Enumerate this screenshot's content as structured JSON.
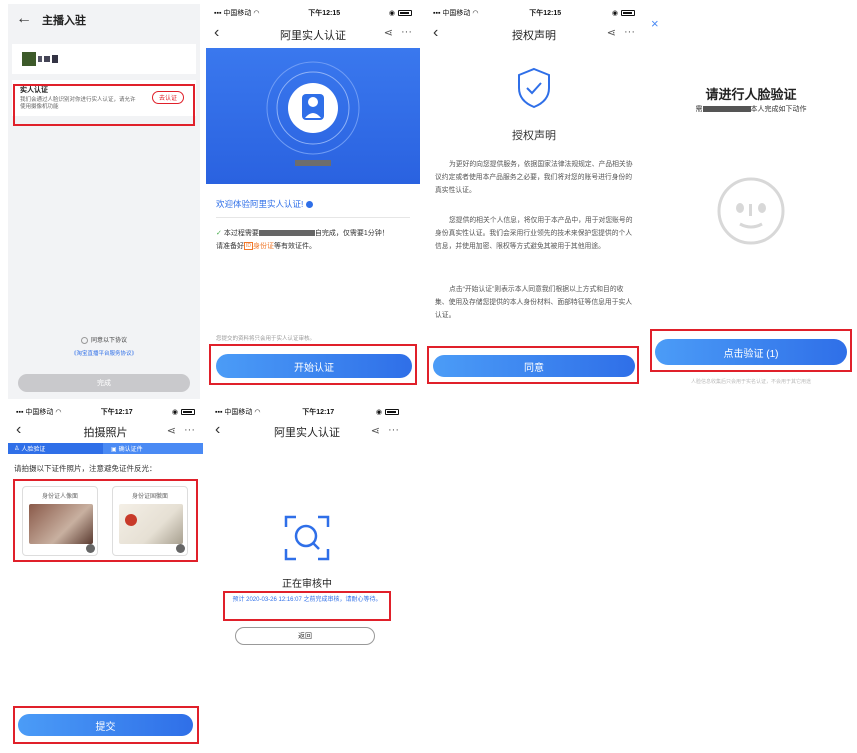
{
  "status": {
    "carrier": "中国移动",
    "time1": "下午12:15",
    "time2": "下午12:17"
  },
  "p1": {
    "title": "主播入驻",
    "verify_title": "实人认证",
    "verify_desc": "我们会通过人脸识别对你进行实人认证，请允许使用摄像机功能",
    "verify_btn": "去认证",
    "agree": "同意以下协议",
    "agreement": "《淘宝直播平台服务协议》",
    "done": "完成"
  },
  "p2": {
    "title": "阿里实人认证",
    "welcome": "欢迎体验阿里实人认证!",
    "line1a": "本过程需要",
    "line1b": "自完成，仅需要1分钟！",
    "line2a": "请准备好",
    "id_label": "身份证",
    "line2b": "等有效证件。",
    "footnote": "您提交的资料将只会用于实人认证审核。",
    "start": "开始认证"
  },
  "p3": {
    "title": "授权声明",
    "heading": "授权声明",
    "para1": "为更好的向您提供服务，依据国家法律法规规定、产品相关协议约定或者使用本产品服务之必要，我们将对您的账号进行身份的真实性认证。",
    "para2": "您提供的相关个人信息，将仅用于本产品中，用于对您账号的身份真实性认证。我们会采用行业领先的技术来保护您提供的个人信息，并使用加密、限权等方式避免其被用于其他用途。",
    "para3": "点击“开始认证”则表示本人同意我们根据以上方式和目的收集、使用及存储您提供的本人身份材料、面部特征等信息用于实人认证。",
    "agree": "同意"
  },
  "p4": {
    "close": "×",
    "heading": "请进行人脸验证",
    "sub_a": "需",
    "sub_b": "本人完成如下动作",
    "button": "点击验证 (1)",
    "note": "人脸信息收集后只会用于实名认证，不会用于其它用途"
  },
  "p5": {
    "title": "拍摄照片",
    "step1": "人脸验证",
    "step2": "确认证件",
    "instruction": "请拍摄以下证件照片，注意避免证件反光：",
    "card1": "身份证人像面",
    "card2": "身份证国徽面",
    "submit": "提交"
  },
  "p6": {
    "title": "阿里实人认证",
    "status": "正在审核中",
    "eta": "预计 2020-03-26 12:16:07 之前完成审核，请耐心等待。",
    "back": "返回"
  },
  "colors": {
    "accent": "#2f6fe8",
    "red_box": "#e0202a",
    "p2_banner": "#2f6fe8"
  }
}
